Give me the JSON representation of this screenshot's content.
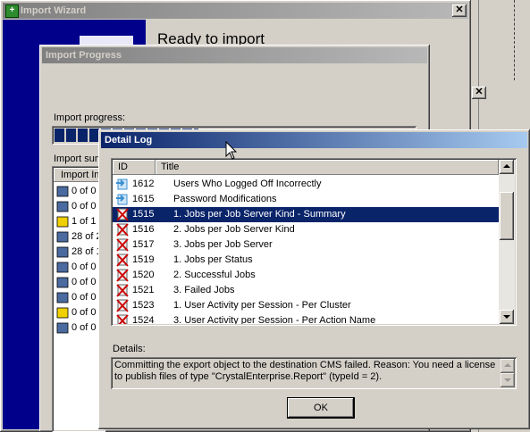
{
  "import_wizard": {
    "title": "Import Wizard",
    "heading": "Ready to import"
  },
  "import_progress": {
    "title": "Import Progress",
    "progress_label": "Import progress:",
    "progress_fraction": 0.4,
    "summary_label": "Import sum",
    "summary_column": "Import Inf",
    "summary_rows": [
      "0 of 0",
      "0 of 0",
      "1 of 1",
      "28 of 2",
      "28 of 1",
      "0 of 0",
      "0 of 0",
      "0 of 0",
      "0 of 0",
      "0 of 0"
    ]
  },
  "detail_log": {
    "title": "Detail Log",
    "columns": {
      "id": "ID",
      "title": "Title"
    },
    "rows": [
      {
        "id": "1612",
        "title": "Users Who Logged Off Incorrectly",
        "icon": "report-ok-icon",
        "selected": false
      },
      {
        "id": "1615",
        "title": "Password Modifications",
        "icon": "report-ok-icon",
        "selected": false
      },
      {
        "id": "1515",
        "title": "1. Jobs per Job Server Kind - Summary",
        "icon": "report-failed-icon",
        "selected": true
      },
      {
        "id": "1516",
        "title": "2. Jobs per Job Server Kind",
        "icon": "report-failed-icon",
        "selected": false
      },
      {
        "id": "1517",
        "title": "3. Jobs per Job Server",
        "icon": "report-failed-icon",
        "selected": false
      },
      {
        "id": "1519",
        "title": "1. Jobs per Status",
        "icon": "report-failed-icon",
        "selected": false
      },
      {
        "id": "1520",
        "title": "2. Successful Jobs",
        "icon": "report-failed-icon",
        "selected": false
      },
      {
        "id": "1521",
        "title": "3. Failed Jobs",
        "icon": "report-failed-icon",
        "selected": false
      },
      {
        "id": "1523",
        "title": "1. User Activity per Session - Per Cluster",
        "icon": "report-failed-icon",
        "selected": false
      },
      {
        "id": "1524",
        "title": "3. User Activity per Session - Per Action Name",
        "icon": "report-failed-icon",
        "selected": false
      }
    ],
    "details_label": "Details:",
    "details_text": "Committing the export object to the destination CMS failed. Reason: You need a license to publish files of type \"CrystalEnterprise.Report\" (typeId = 2).",
    "ok_label": "OK"
  },
  "colors": {
    "wizard_banner": "#00008b",
    "selection": "#0a246a",
    "fail_mark": "#cc0000",
    "ok_icon": "#3a8fd0"
  }
}
